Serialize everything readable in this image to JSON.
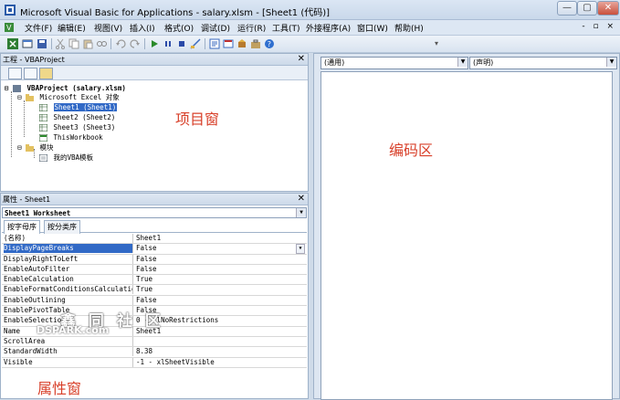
{
  "window": {
    "title": "Microsoft Visual Basic for Applications - salary.xlsm - [Sheet1 (代码)]",
    "buttons": {
      "minimize": "—",
      "maximize": "▢",
      "close": "✕"
    }
  },
  "menu": {
    "items": [
      "文件(F)",
      "编辑(E)",
      "视图(V)",
      "插入(I)",
      "格式(O)",
      "调试(D)",
      "运行(R)",
      "工具(T)",
      "外接程序(A)",
      "窗口(W)",
      "帮助(H)"
    ],
    "mdi_controls": "- ▫ ×"
  },
  "toolbar": {
    "icons": [
      "excel-icon",
      "insert-userform-icon",
      "save-icon",
      "cut-icon",
      "copy-icon",
      "paste-icon",
      "find-icon",
      "undo-icon",
      "redo-icon",
      "run-icon",
      "break-icon",
      "reset-icon",
      "design-mode-icon",
      "project-explorer-icon",
      "properties-icon",
      "object-browser-icon",
      "toolbox-icon",
      "help-icon"
    ]
  },
  "project_panel": {
    "title": "工程 - VBAProject",
    "close": "✕",
    "label": "项目窗",
    "tree": {
      "root": "VBAProject (salary.xlsm)",
      "folder_objects": "Microsoft Excel 对象",
      "sheets": [
        "Sheet1 (Sheet1)",
        "Sheet2 (Sheet2)",
        "Sheet3 (Sheet3)",
        "ThisWorkbook"
      ],
      "folder_modules": "模块",
      "module": "我的VBA模板"
    }
  },
  "properties_panel": {
    "title": "属性 - Sheet1",
    "close": "✕",
    "object_selector": "Sheet1 Worksheet",
    "tabs": [
      "按字母序",
      "按分类序"
    ],
    "label": "属性窗",
    "rows": [
      {
        "name": "(名称)",
        "value": "Sheet1"
      },
      {
        "name": "DisplayPageBreaks",
        "value": "False"
      },
      {
        "name": "DisplayRightToLeft",
        "value": "False"
      },
      {
        "name": "EnableAutoFilter",
        "value": "False"
      },
      {
        "name": "EnableCalculation",
        "value": "True"
      },
      {
        "name": "EnableFormatConditionsCalculation",
        "value": "True"
      },
      {
        "name": "EnableOutlining",
        "value": "False"
      },
      {
        "name": "EnablePivotTable",
        "value": "False"
      },
      {
        "name": "EnableSelection",
        "value": "0 - xlNoRestrictions"
      },
      {
        "name": "Name",
        "value": "Sheet1"
      },
      {
        "name": "ScrollArea",
        "value": ""
      },
      {
        "name": "StandardWidth",
        "value": "8.38"
      },
      {
        "name": "Visible",
        "value": "-1 - xlSheetVisible"
      }
    ]
  },
  "code_window": {
    "object_combo": "(通用)",
    "procedure_combo": "(声明)",
    "label": "编码区"
  },
  "watermark": {
    "cn": "鑫 同 社 区",
    "en": "DSPARK.com"
  }
}
